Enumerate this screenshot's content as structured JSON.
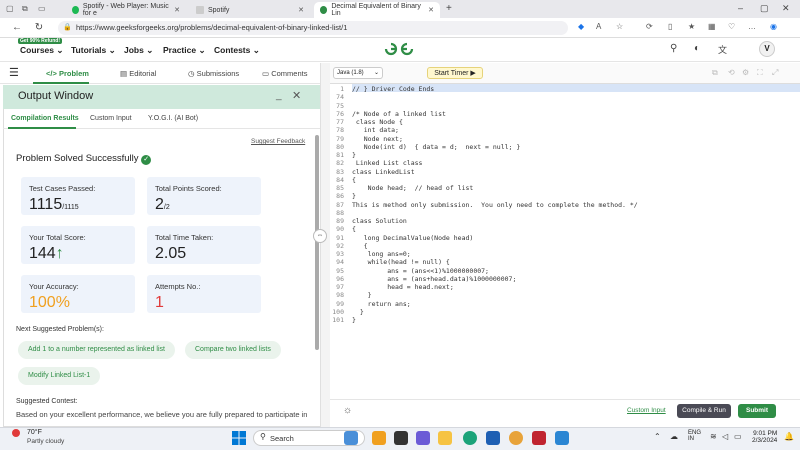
{
  "browser": {
    "tabs": [
      {
        "label": "Spotify - Web Player: Music for e",
        "active": false
      },
      {
        "label": "Spotify",
        "active": false
      },
      {
        "label": "Decimal Equivalent of Binary Lin",
        "active": true
      }
    ],
    "url": "https://www.geeksforgeeks.org/problems/decimal-equivalent-of-binary-linked-list/1"
  },
  "site": {
    "promo": "Get 90% Refund!",
    "menu": [
      "Courses",
      "Tutorials",
      "Jobs",
      "Practice",
      "Contests"
    ],
    "logo": "GG",
    "avatar": "V"
  },
  "problem_tabs": [
    "Problem",
    "Editorial",
    "Submissions",
    "Comments"
  ],
  "output": {
    "title": "Output Window",
    "tabs": [
      "Compilation Results",
      "Custom Input",
      "Y.O.G.I. (AI Bot)"
    ],
    "suggest_feedback": "Suggest Feedback",
    "status": "Problem Solved Successfully",
    "cards": {
      "test_cases_label": "Test Cases Passed:",
      "test_cases_value": "1115",
      "test_cases_total": "/1115",
      "points_label": "Total Points Scored:",
      "points_value": "2",
      "points_total": "/2",
      "score_label": "Your Total Score:",
      "score_value": "144",
      "time_label": "Total Time Taken:",
      "time_value": "2.05",
      "accuracy_label": "Your Accuracy:",
      "accuracy_value": "100%",
      "attempts_label": "Attempts No.:",
      "attempts_value": "1"
    },
    "next_label": "Next Suggested Problem(s):",
    "suggestions": [
      "Add 1 to a number represented as linked list",
      "Compare two linked lists",
      "Modify Linked List-1"
    ],
    "contest_label": "Suggested Contest:",
    "contest_text": "Based on your excellent performance, we believe you are fully prepared to participate in"
  },
  "editor": {
    "language": "Java (1.8)",
    "timer": "Start Timer",
    "lines": [
      {
        "n": "1",
        "t": "// } Driver Code Ends"
      },
      {
        "n": "74",
        "t": ""
      },
      {
        "n": "75",
        "t": ""
      },
      {
        "n": "76",
        "t": "/* Node of a linked list"
      },
      {
        "n": "77",
        "t": " class Node {"
      },
      {
        "n": "78",
        "t": "   int data;"
      },
      {
        "n": "79",
        "t": "   Node next;"
      },
      {
        "n": "80",
        "t": "   Node(int d)  { data = d;  next = null; }"
      },
      {
        "n": "81",
        "t": "}"
      },
      {
        "n": "82",
        "t": " Linked List class"
      },
      {
        "n": "83",
        "t": "class LinkedList"
      },
      {
        "n": "84",
        "t": "{"
      },
      {
        "n": "85",
        "t": "    Node head;  // head of list"
      },
      {
        "n": "86",
        "t": "}"
      },
      {
        "n": "87",
        "t": "This is method only submission.  You only need to complete the method. */"
      },
      {
        "n": "88",
        "t": ""
      },
      {
        "n": "89",
        "t": "class Solution"
      },
      {
        "n": "90",
        "t": "{"
      },
      {
        "n": "91",
        "t": "   long DecimalValue(Node head)"
      },
      {
        "n": "92",
        "t": "   {"
      },
      {
        "n": "93",
        "t": "    long ans=0;"
      },
      {
        "n": "94",
        "t": "    while(head != null) {"
      },
      {
        "n": "95",
        "t": "         ans = (ans<<1)%1000000007;"
      },
      {
        "n": "96",
        "t": "         ans = (ans+head.data)%1000000007;"
      },
      {
        "n": "97",
        "t": "         head = head.next;"
      },
      {
        "n": "98",
        "t": "    }"
      },
      {
        "n": "99",
        "t": "    return ans;"
      },
      {
        "n": "100",
        "t": "  }"
      },
      {
        "n": "101",
        "t": "}"
      }
    ],
    "custom_input": "Custom Input",
    "compile": "Compile & Run",
    "submit": "Submit"
  },
  "taskbar": {
    "weather_temp": "70°F",
    "weather_desc": "Partly cloudy",
    "search": "Search",
    "lang_top": "ENG",
    "lang_bottom": "IN",
    "time": "9:01 PM",
    "date": "2/3/2024"
  },
  "colors": {
    "accent": "#2f8d46",
    "accuracy": "#f0a020",
    "attempts": "#e03a3a"
  }
}
